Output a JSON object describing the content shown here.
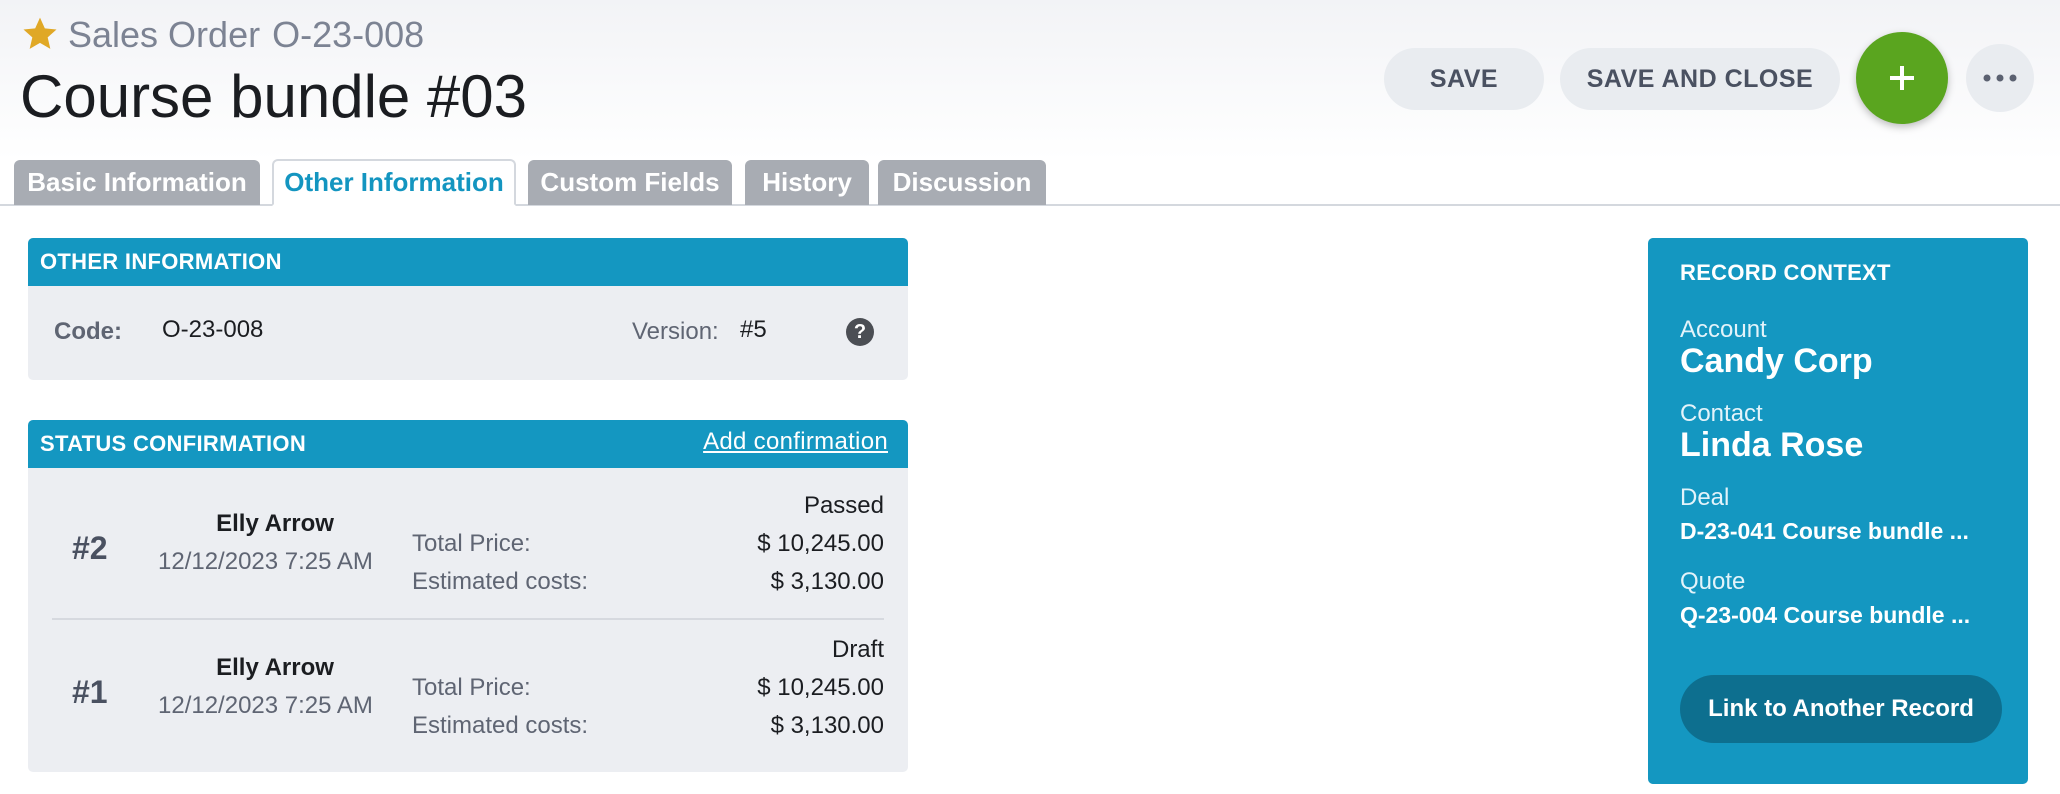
{
  "header": {
    "entity_type": "Sales Order",
    "entity_code": "O-23-008",
    "record_title": "Course bundle #03",
    "favorite_icon": "star-icon",
    "accent_color": "#e0a826"
  },
  "toolbar": {
    "save_label": "SAVE",
    "save_close_label": "SAVE AND CLOSE",
    "add_icon": "plus-icon",
    "add_color": "#5aa51f",
    "more_icon": "more-horizontal-icon"
  },
  "tabs": [
    {
      "label": "Basic Information",
      "active": false
    },
    {
      "label": "Other Information",
      "active": true
    },
    {
      "label": "Custom Fields",
      "active": false
    },
    {
      "label": "History",
      "active": false
    },
    {
      "label": "Discussion",
      "active": false
    }
  ],
  "other_information": {
    "title": "OTHER INFORMATION",
    "code_label": "Code:",
    "code_value": "O-23-008",
    "version_label": "Version:",
    "version_value": "#5",
    "help_icon": "help-icon"
  },
  "status_confirmation": {
    "title": "STATUS CONFIRMATION",
    "add_label": "Add confirmation",
    "rows": [
      {
        "number": "#2",
        "user": "Elly Arrow",
        "date": "12/12/2023 7:25 AM",
        "status": "Passed",
        "total_price_label": "Total Price:",
        "total_price": "$ 10,245.00",
        "estimated_costs_label": "Estimated costs:",
        "estimated_costs": "$ 3,130.00"
      },
      {
        "number": "#1",
        "user": "Elly Arrow",
        "date": "12/12/2023 7:25 AM",
        "status": "Draft",
        "total_price_label": "Total Price:",
        "total_price": "$ 10,245.00",
        "estimated_costs_label": "Estimated costs:",
        "estimated_costs": "$ 3,130.00"
      }
    ]
  },
  "record_context": {
    "title": "RECORD CONTEXT",
    "account_label": "Account",
    "account_value": "Candy Corp",
    "contact_label": "Contact",
    "contact_value": "Linda Rose",
    "deal_label": "Deal",
    "deal_value": "D-23-041 Course bundle ...",
    "quote_label": "Quote",
    "quote_value": "Q-23-004 Course bundle ...",
    "link_button_label": "Link to Another Record",
    "panel_color": "#1497c1"
  }
}
